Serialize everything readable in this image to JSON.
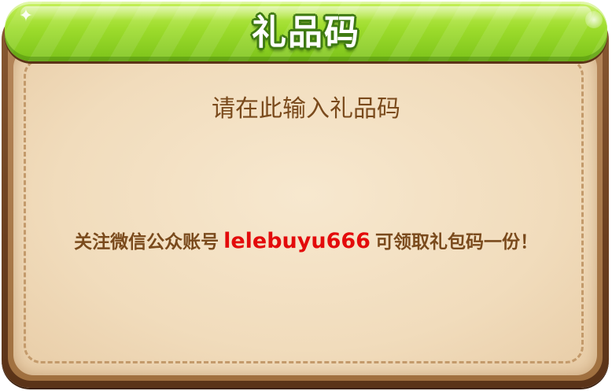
{
  "dialog": {
    "title": "礼品码"
  },
  "input": {
    "placeholder": "请在此输入礼品码",
    "value": ""
  },
  "notice": {
    "prefix": "关注微信公众账号",
    "account": "lelebuyu666",
    "suffix": "可领取礼包码一份！"
  },
  "colors": {
    "header_green": "#9ddc2c",
    "frame_brown": "#6b3f1f",
    "parchment": "#f1dcbc",
    "text_brown": "#7a4a1c",
    "accent_red": "#e30b0b"
  },
  "icons": {
    "header_sparkle": "sparkle-icon"
  }
}
